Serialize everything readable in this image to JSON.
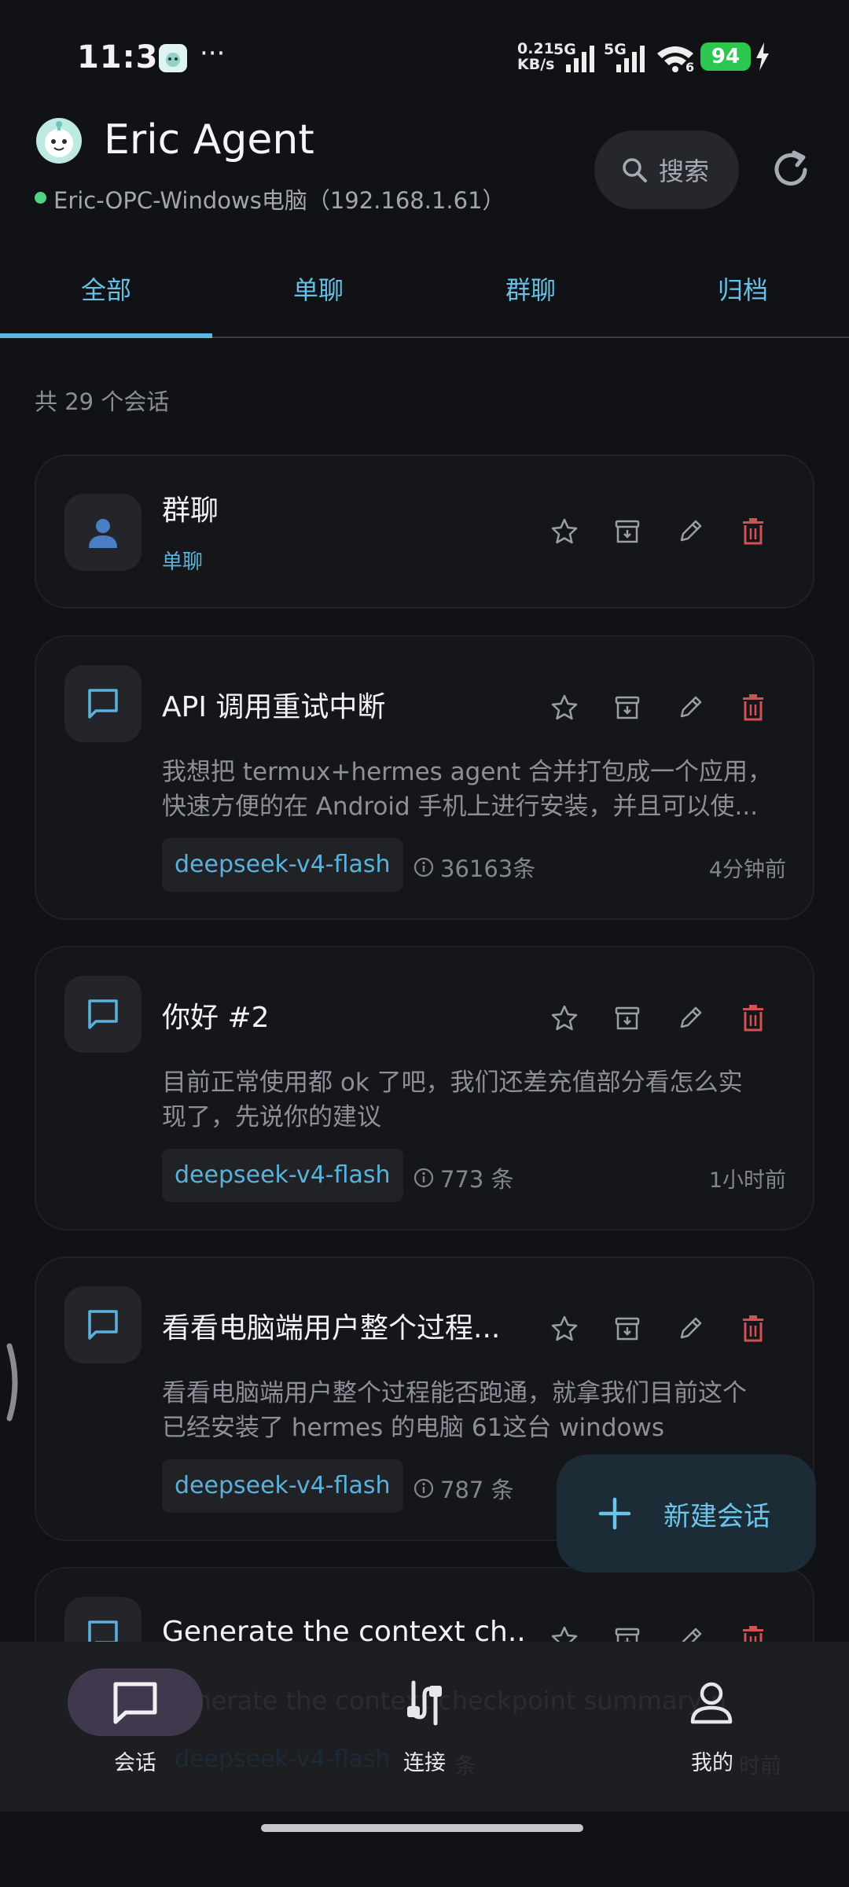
{
  "status_bar": {
    "time": "11:32",
    "more": "···",
    "net_speed_value": "0.21",
    "net_speed_unit": "KB/s",
    "sim1": "5G",
    "sim2": "5G",
    "wifi_badge": "6",
    "battery": "94"
  },
  "header": {
    "title": "Eric Agent",
    "connection": "Eric-OPC-Windows电脑（192.168.1.61）",
    "search_label": "搜索"
  },
  "tabs": [
    {
      "label": "全部",
      "active": true
    },
    {
      "label": "单聊",
      "active": false
    },
    {
      "label": "群聊",
      "active": false
    },
    {
      "label": "归档",
      "active": false
    }
  ],
  "summary": {
    "count_text": "共 29 个会话"
  },
  "conversations": [
    {
      "title": "群聊",
      "subtitle": "单聊"
    },
    {
      "title": "API 调用重试中断",
      "preview_line1": "我想把 termux+hermes agent 合并打包成一个应用，",
      "preview_line2": "快速方便的在 Android 手机上进行安装，并且可以使...",
      "model": "deepseek-v4-flash",
      "messages": "36163条",
      "time": "4分钟前"
    },
    {
      "title": "你好 #2",
      "preview_line1": "目前正常使用都 ok 了吧，我们还差充值部分看怎么实",
      "preview_line2": "现了，先说你的建议",
      "model": "deepseek-v4-flash",
      "messages": "773 条",
      "time": "1小时前"
    },
    {
      "title": "看看电脑端用户整个过程...",
      "preview_line1": "看看电脑端用户整个过程能否跑通，就拿我们目前这个",
      "preview_line2": "已经安装了 hermes 的电脑 61这台 windows",
      "model": "deepseek-v4-flash",
      "messages": "787 条"
    },
    {
      "title": "Generate the context ch...",
      "preview_line1": "Generate the context checkpoint summary n",
      "model": "deepseek-v4-flash",
      "messages": "条",
      "time": "时前"
    }
  ],
  "fab": {
    "label": "新建会话"
  },
  "bottom_nav": [
    {
      "label": "会话",
      "active": true
    },
    {
      "label": "连接",
      "active": false
    },
    {
      "label": "我的",
      "active": false
    }
  ],
  "colors": {
    "accent": "#5ab8e4",
    "danger": "#d05252",
    "online": "#4fd483",
    "background": "#111216",
    "card": "#15161a"
  }
}
